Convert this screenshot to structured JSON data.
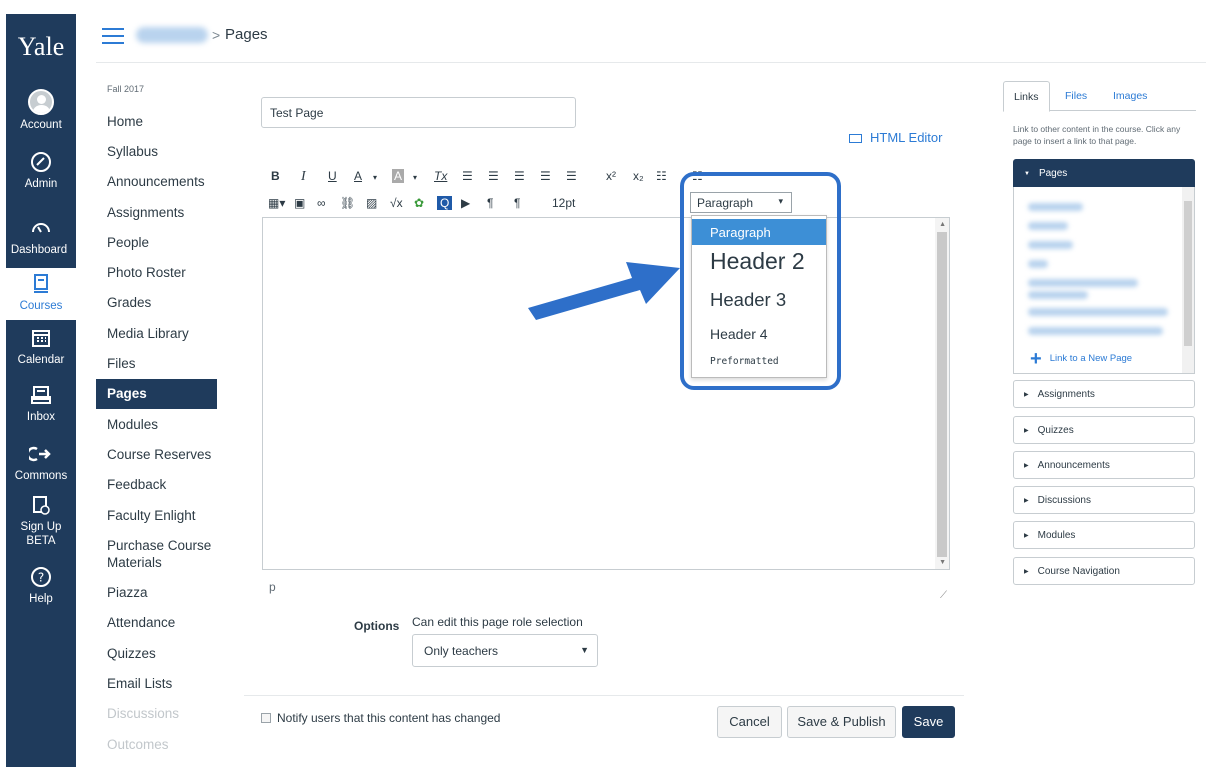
{
  "global_nav": {
    "logo": "Yale",
    "items": [
      {
        "label": "Account",
        "icon": "account-avatar-icon"
      },
      {
        "label": "Admin",
        "icon": "admin-shield-icon"
      },
      {
        "label": "Dashboard",
        "icon": "dashboard-gauge-icon"
      },
      {
        "label": "Courses",
        "icon": "courses-book-icon"
      },
      {
        "label": "Calendar",
        "icon": "calendar-icon"
      },
      {
        "label": "Inbox",
        "icon": "inbox-icon"
      },
      {
        "label": "Commons",
        "icon": "commons-arrow-icon"
      },
      {
        "label": "Sign Up",
        "label2": "BETA",
        "icon": "signup-calendar-clock-icon"
      },
      {
        "label": "Help",
        "icon": "help-question-icon"
      }
    ]
  },
  "breadcrumb": {
    "separator": ">",
    "current": "Pages"
  },
  "course_nav": {
    "term": "Fall 2017",
    "items": [
      "Home",
      "Syllabus",
      "Announcements",
      "Assignments",
      "People",
      "Photo Roster",
      "Grades",
      "Media Library",
      "Files",
      "Pages",
      "Modules",
      "Course Reserves",
      "Feedback",
      "Faculty Enlight",
      "Purchase Course",
      "Materials",
      "Piazza",
      "Attendance",
      "Quizzes",
      "Email Lists",
      "Discussions",
      "Outcomes"
    ]
  },
  "editor": {
    "title_value": "Test Page",
    "html_editor_label": "HTML Editor",
    "font_size": "12pt",
    "path": "p",
    "format_select": "Paragraph",
    "format_options": [
      "Paragraph",
      "Header 2",
      "Header 3",
      "Header 4",
      "Preformatted"
    ],
    "toolbar_row1": [
      "B",
      "I",
      "U",
      "A",
      "A",
      "Tx"
    ],
    "toolbar_row2_label": "12pt"
  },
  "options": {
    "label": "Options",
    "description": "Can edit this page role selection",
    "selected": "Only teachers"
  },
  "footer": {
    "notify_label": "Notify users that this content has changed",
    "cancel": "Cancel",
    "save_publish": "Save & Publish",
    "save": "Save"
  },
  "sidebar": {
    "tabs": [
      "Links",
      "Files",
      "Images"
    ],
    "description": "Link to other content in the course. Click any page to insert a link to that page.",
    "sections": [
      "Pages",
      "Assignments",
      "Quizzes",
      "Announcements",
      "Discussions",
      "Modules",
      "Course Navigation"
    ],
    "new_page_label": "Link to a New Page"
  },
  "colors": {
    "nav": "#1f3b5c",
    "link": "#2c7bd5",
    "highlight": "#2e6fc9",
    "selected_option": "#3d8fd6"
  }
}
